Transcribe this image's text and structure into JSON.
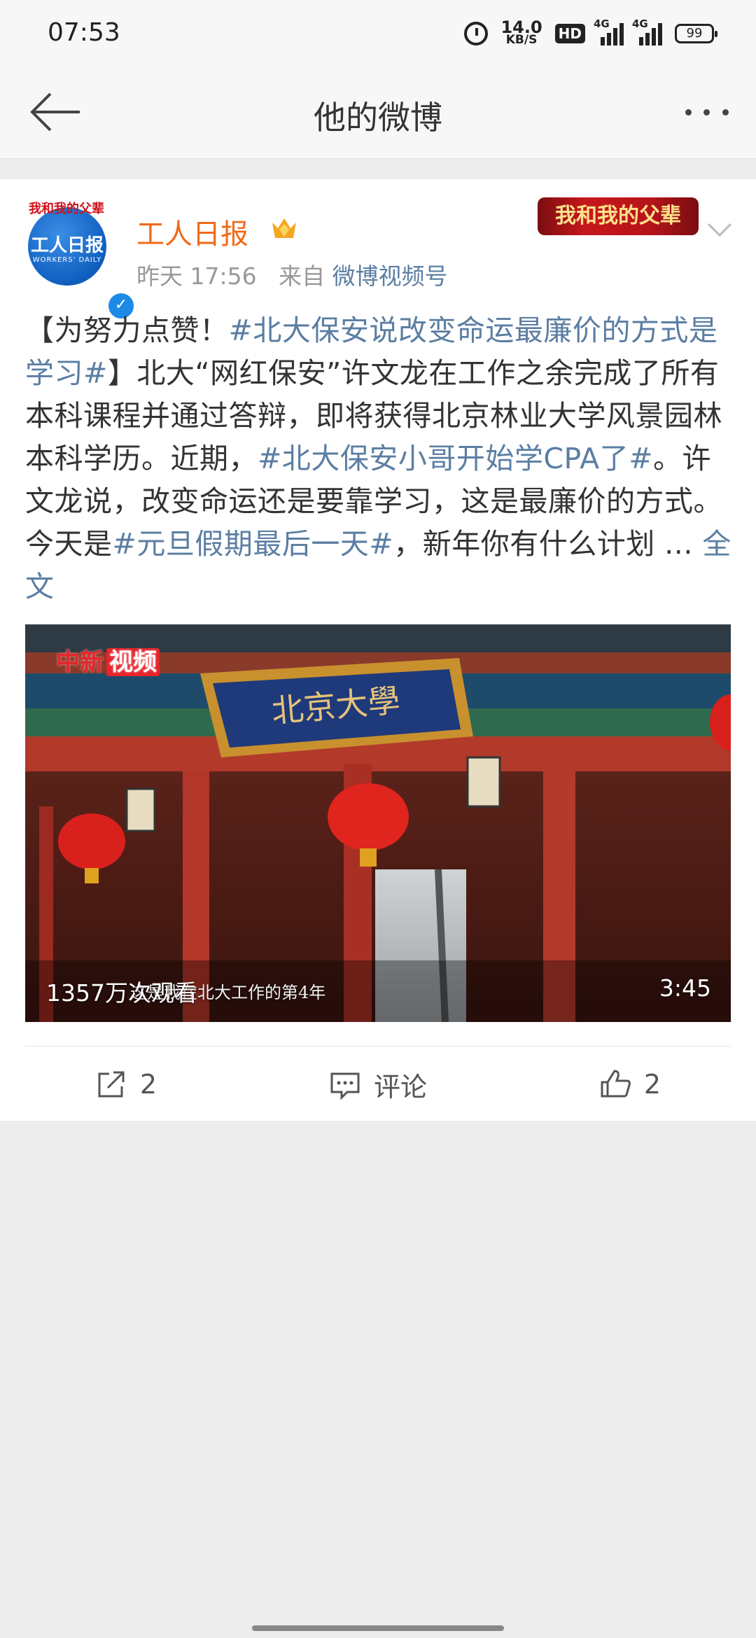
{
  "status_bar": {
    "time": "07:53",
    "net_speed": "14.0",
    "net_unit": "KB/S",
    "hd": "HD",
    "sig1": "4G",
    "sig2": "4G",
    "battery": "99"
  },
  "header": {
    "title": "他的微博",
    "back_icon": "arrow-left-icon",
    "more_icon": "more-dots-icon"
  },
  "post": {
    "avatar_text": "工人日报",
    "avatar_sub": "WORKERS' DAILY",
    "avatar_top": "我和我的父辈",
    "username": "工人日报",
    "time": "昨天 17:56",
    "from_label": "来自",
    "source": "微博视频号",
    "banner_text": "我和我的父辈",
    "text": {
      "p1": "【为努力点赞！",
      "tag1": "#北大保安说改变命运最廉价的方式是学习#",
      "p2": "】北大“网红保安”许文龙在工作之余完成了所有本科课程并通过答辩，即将获得北京林业大学风景园林本科学历。近期，",
      "tag2": "#北大保安小哥开始学CPA了#",
      "p3": "。许文龙说，改变命运还是要靠学习，这是最廉价的方式。今天是",
      "tag3": "#元旦假期最后一天#",
      "p4": "，新年你有什么计划 ... ",
      "full_link": "全文"
    },
    "video": {
      "watermark": "中新",
      "watermark2": "视频",
      "plaque": "北京大學",
      "views": "1357万次观看",
      "subtitle": "这是我在北大工作的第4年",
      "duration": "3:45"
    },
    "actions": {
      "share_count": "2",
      "comment_label": "评论",
      "like_count": "2"
    }
  },
  "colors": {
    "username": "#f06a1a",
    "link": "#5b7ea3",
    "background": "#ededed"
  }
}
